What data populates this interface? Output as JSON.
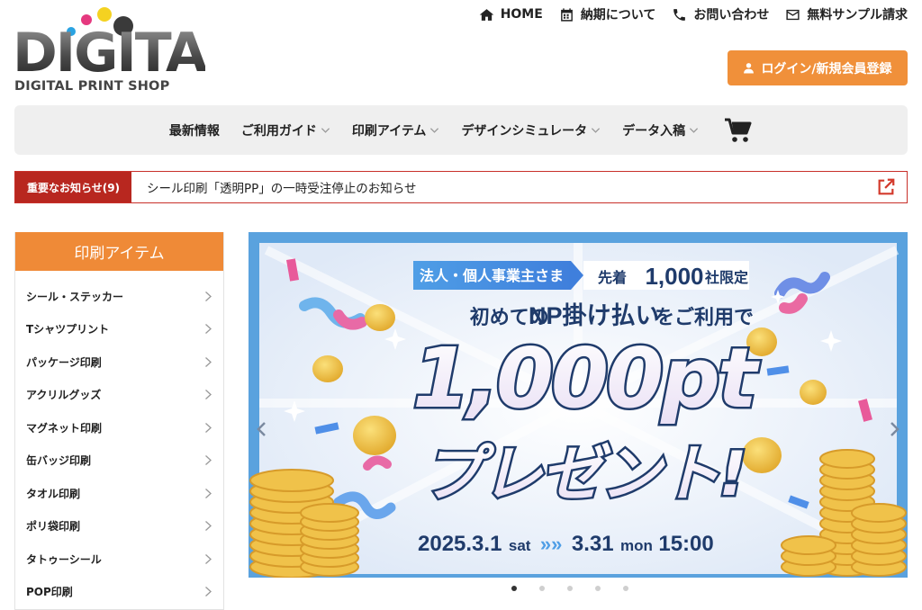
{
  "logo": {
    "word": "DIGITA",
    "sub": "DIGITAL PRINT SHOP",
    "dot_colors": [
      "#e5397f",
      "#f4d221",
      "#2aa3e2",
      "#3a3a3a"
    ]
  },
  "topnav": [
    {
      "label": "HOME",
      "icon": "home-icon"
    },
    {
      "label": "納期について",
      "icon": "calendar-icon"
    },
    {
      "label": "お問い合わせ",
      "icon": "phone-icon"
    },
    {
      "label": "無料サンプル請求",
      "icon": "mail-icon"
    }
  ],
  "login": {
    "label": "ログイン/新規会員登録",
    "icon": "user-icon"
  },
  "mainnav": [
    {
      "label": "最新情報",
      "has_dropdown": false
    },
    {
      "label": "ご利用ガイド",
      "has_dropdown": true
    },
    {
      "label": "印刷アイテム",
      "has_dropdown": true
    },
    {
      "label": "デザインシミュレータ",
      "has_dropdown": true
    },
    {
      "label": "データ入稿",
      "has_dropdown": true
    }
  ],
  "notice": {
    "tag": "重要なお知らせ(9)",
    "text": "シール印刷「透明PP」の一時受注停止のお知らせ"
  },
  "sidebar": {
    "title": "印刷アイテム",
    "items": [
      "シール・ステッカー",
      "Tシャツプリント",
      "パッケージ印刷",
      "アクリルグッズ",
      "マグネット印刷",
      "缶バッジ印刷",
      "タオル印刷",
      "ポリ袋印刷",
      "タトゥーシール",
      "POP印刷"
    ]
  },
  "banner": {
    "pill_left": "法人・個人事業主さま",
    "pill_right_prefix": "先着",
    "pill_right_number": "1,000",
    "pill_right_suffix": "社限定",
    "headline_a": "初めての",
    "headline_b": "NP掛け払い",
    "headline_c": "をご利用で",
    "big_number": "1,000pt",
    "present": "プレゼント!",
    "date_start": "2025.3.1",
    "date_start_day": "sat",
    "date_sep": "»»",
    "date_end": "3.31",
    "date_end_day": "mon",
    "date_end_time": "15:00"
  },
  "carousel": {
    "slides": 5,
    "active": 1
  },
  "colors": {
    "accent": "#f0903a",
    "notice_red": "#b8271f",
    "banner_blue": "#5aa2de",
    "coin": "#f0c24a"
  }
}
